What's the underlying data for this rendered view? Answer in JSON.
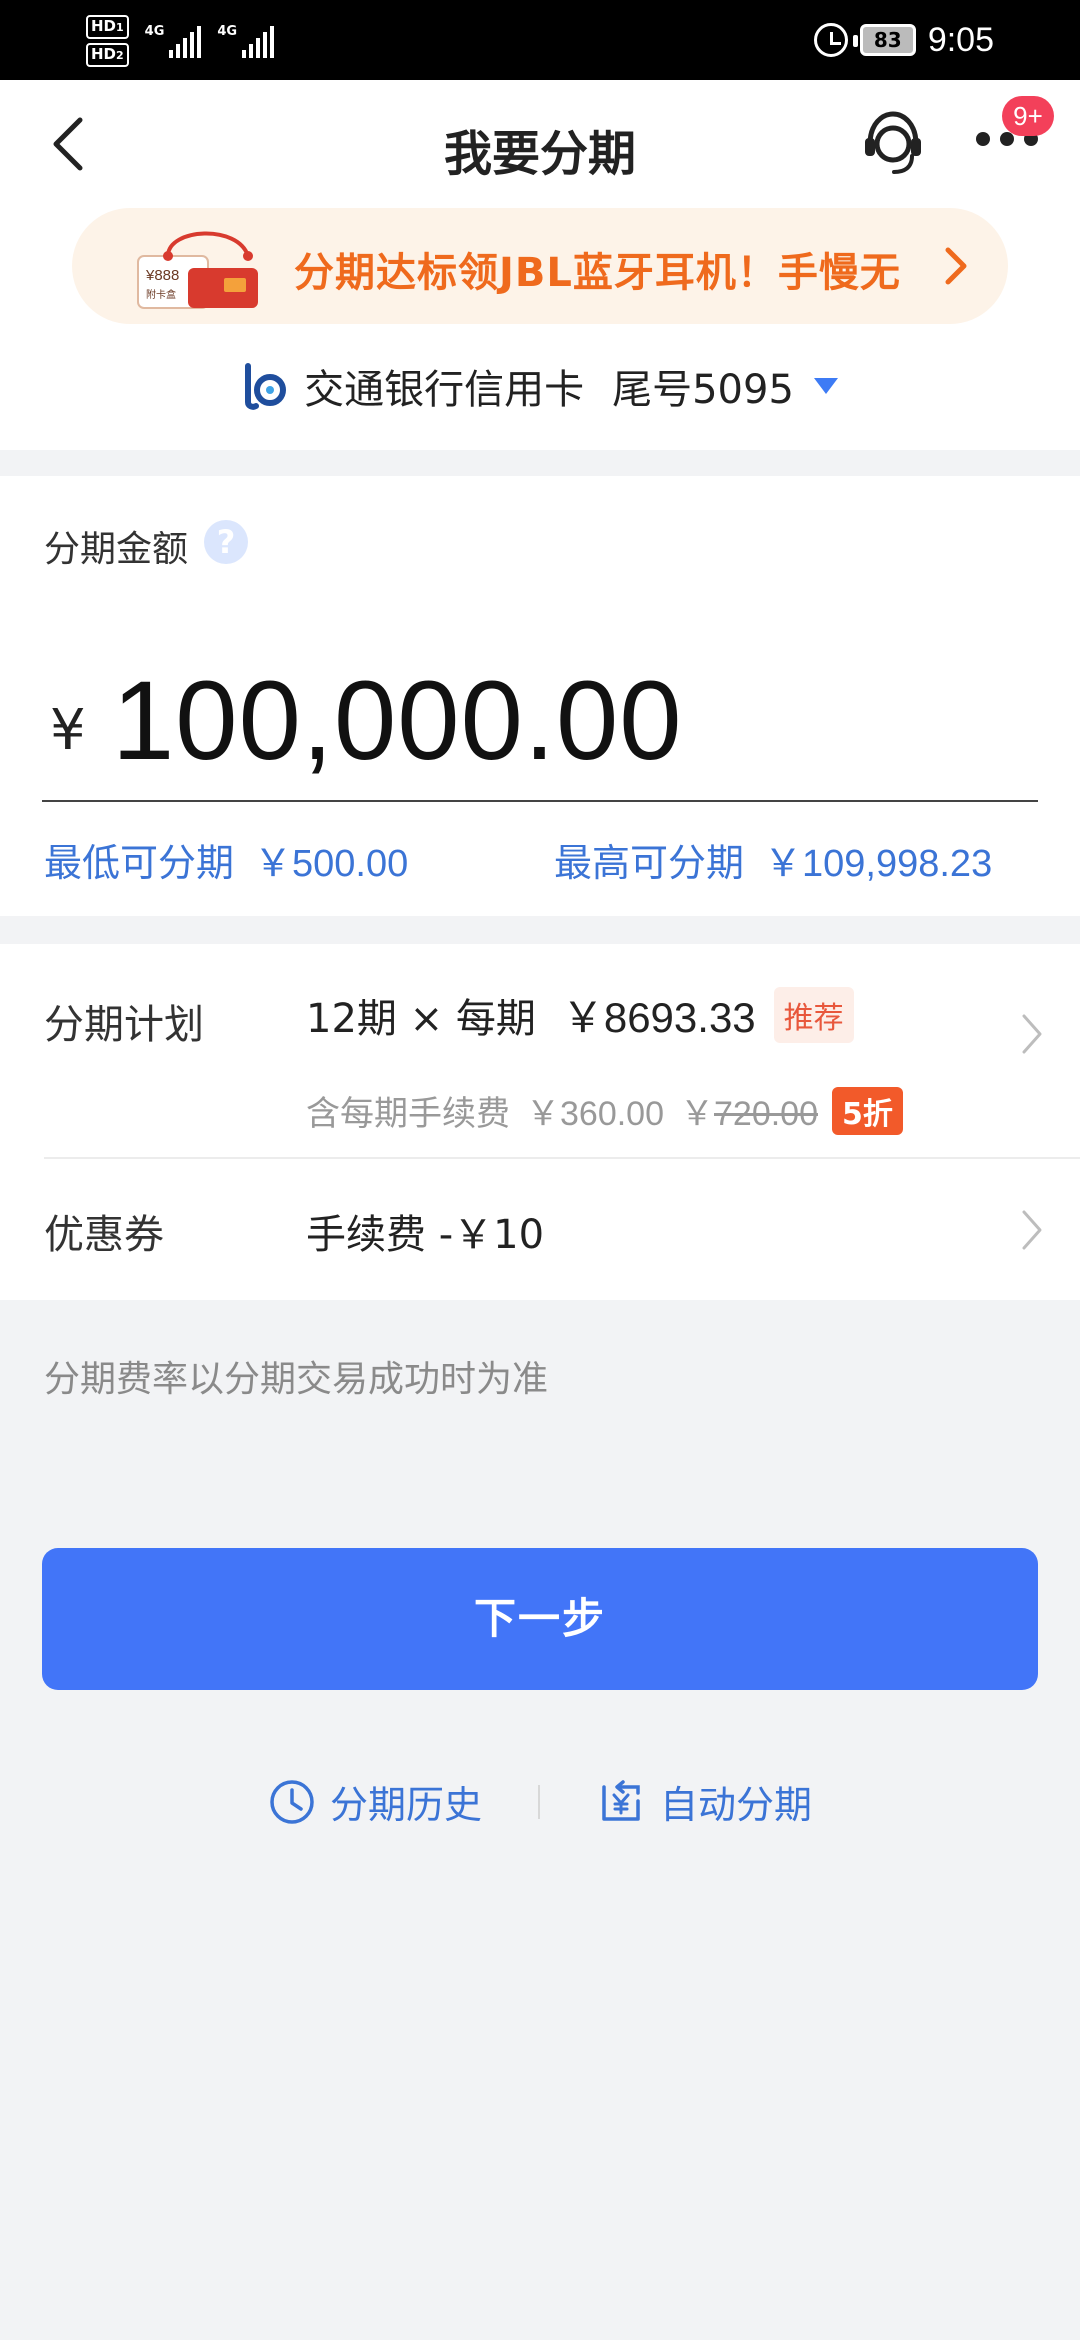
{
  "status_bar": {
    "hd1": "HD",
    "hd1_sub": "1",
    "hd2": "HD",
    "hd2_sub": "2",
    "net1": "4G",
    "net2": "4G",
    "battery": "83",
    "time": "9:05"
  },
  "header": {
    "title": "我要分期",
    "badge": "9+"
  },
  "promo": {
    "text": "分期达标领JBL蓝牙耳机！手慢无",
    "img_price": "¥888",
    "img_note": "附卡盒"
  },
  "card": {
    "bank_name": "交通银行信用卡",
    "card_suffix": "尾号5095"
  },
  "amount": {
    "label": "分期金额",
    "help": "?",
    "currency": "¥",
    "value": "100,000.00",
    "min_label": "最低可分期",
    "min_value": "￥500.00",
    "max_label": "最高可分期",
    "max_value": "￥109,998.23"
  },
  "plan": {
    "label": "分期计划",
    "periods": "12期 × 每期",
    "per_period": "￥8693.33",
    "recommend_tag": "推荐",
    "fee_label": "含每期手续费",
    "fee_value": "￥360.00",
    "orig_currency": "￥",
    "orig_fee": "720.00",
    "discount_tag": "5折"
  },
  "coupon": {
    "label": "优惠券",
    "value": "手续费 -￥10"
  },
  "note": "分期费率以分期交易成功时为准",
  "next_button": "下一步",
  "links": {
    "history": "分期历史",
    "auto": "自动分期"
  },
  "colors": {
    "primary": "#4275f8",
    "link": "#3b74d6",
    "promo_text": "#ef6a1d",
    "badge": "#f3405a",
    "discount": "#f25a2a"
  }
}
